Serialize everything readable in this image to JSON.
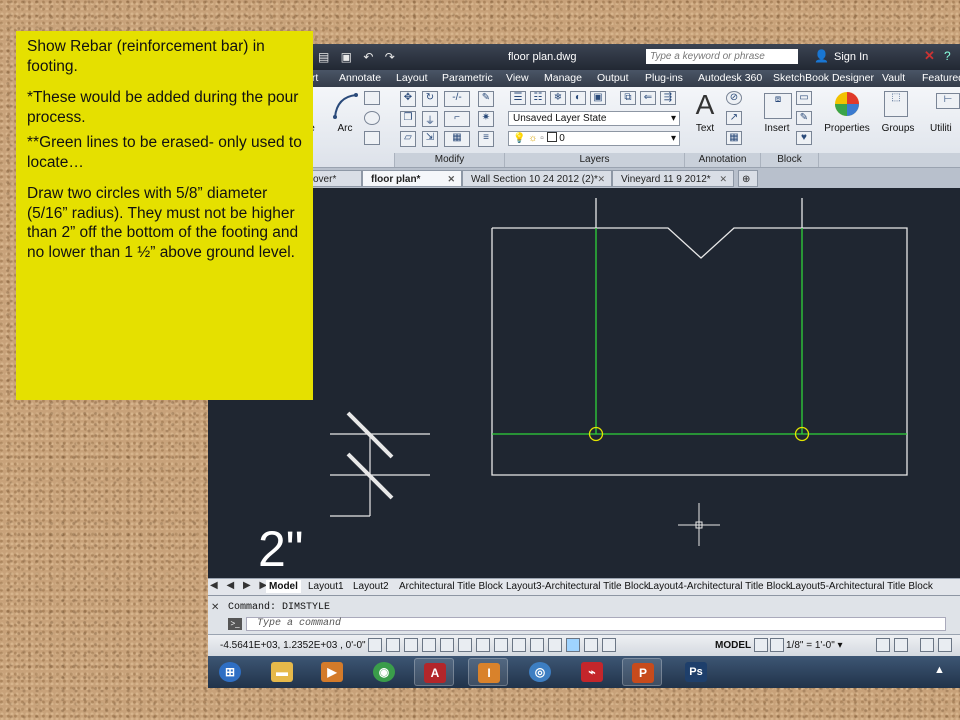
{
  "note": {
    "line1": "Show Rebar (reinforcement bar) in footing.",
    "line2": "*These would be added during the pour process.",
    "line3": "**Green lines to be erased- only used to locate…",
    "line4": "Draw two circles with 5/8” diameter (5/16” radius).  They must not be higher than 2” off the bottom of the footing and no lower than 1 ½” above ground level."
  },
  "titlebar": {
    "doc_title": "floor plan.dwg",
    "search_placeholder": "Type a keyword or phrase",
    "sign_in": "Sign In",
    "close_glyph": "✕",
    "help_glyph": "?",
    "user_glyph": "👤",
    "qat_glyphs": "▤ ▣ ↶ ↷"
  },
  "ribbon_tabs": [
    "ert",
    "Annotate",
    "Layout",
    "Parametric",
    "View",
    "Manage",
    "Output",
    "Plug-ins",
    "Autodesk 360",
    "SketchBook Designer",
    "Vault",
    "Featured"
  ],
  "ribbon": {
    "draw_labels": [
      "e",
      "Arc"
    ],
    "layer_state": "Unsaved Layer State",
    "current_layer": "0",
    "text_label": "Text",
    "insert_label": "Insert",
    "properties_label": "Properties",
    "groups_label": "Groups",
    "utilities_label": "Utiliti",
    "panels": [
      "Modify",
      "Layers",
      "Annotation",
      "Block"
    ],
    "text_glyph": "A",
    "arrow": "▾"
  },
  "doc_tabs": [
    {
      "label": "over*",
      "active": false
    },
    {
      "label": "floor plan*",
      "active": true
    },
    {
      "label": "Wall Section 10 24 2012 (2)*",
      "active": false
    },
    {
      "label": "Vineyard 11 9 2012*",
      "active": false
    }
  ],
  "canvas": {
    "viewport_label": "]",
    "dim_text": "2\""
  },
  "layout_tabs": {
    "nav": "◀ ◀ ▶ ▶",
    "tabs": [
      "Model",
      "Layout1",
      "Layout2",
      "Architectural Title Block",
      "Layout3-Architectural Title Block",
      "Layout4-Architectural Title Block",
      "Layout5-Architectural Title Block"
    ]
  },
  "command": {
    "history": "Command: DIMSTYLE",
    "placeholder": "Type a command",
    "side_glyph": "✕",
    "prompt_glyph": ">_"
  },
  "status": {
    "coords": "-4.5641E+03, 1.2352E+03 , 0'-0\"",
    "model": "MODEL",
    "scale": "1/8\" = 1'-0\" ▾"
  },
  "taskbar": {
    "apps": [
      {
        "name": "start",
        "glyph": "⊞",
        "color": "#2f6fc4"
      },
      {
        "name": "explorer",
        "glyph": "▬",
        "color": "#e6b94a"
      },
      {
        "name": "media",
        "glyph": "▶",
        "color": "#d47b2a"
      },
      {
        "name": "chrome",
        "glyph": "◉",
        "color": "#3a9d4a"
      },
      {
        "name": "autocad",
        "glyph": "A",
        "color": "#b3262a"
      },
      {
        "name": "inventor",
        "glyph": "I",
        "color": "#d9822b"
      },
      {
        "name": "design-review",
        "glyph": "◎",
        "color": "#3d7ec2"
      },
      {
        "name": "acrobat",
        "glyph": "⌁",
        "color": "#c4262b"
      },
      {
        "name": "powerpoint",
        "glyph": "P",
        "color": "#c74b1c"
      },
      {
        "name": "photoshop",
        "glyph": "Ps",
        "color": "#1e3f6b"
      }
    ]
  }
}
